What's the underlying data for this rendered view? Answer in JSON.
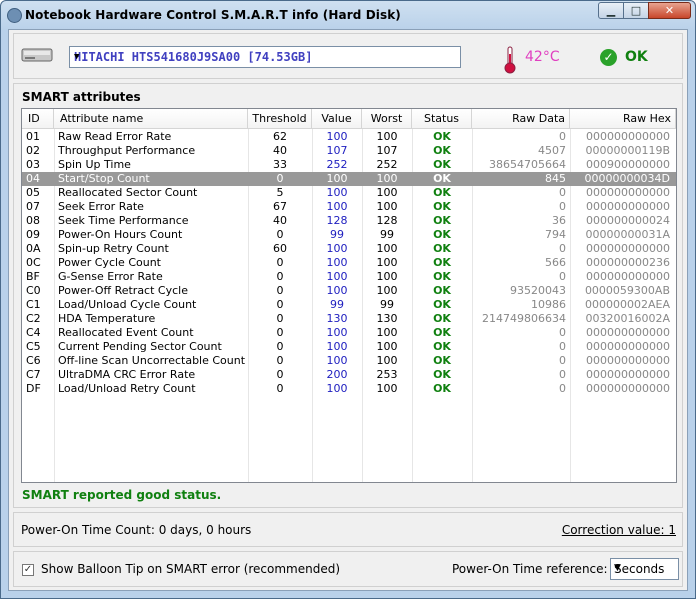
{
  "window": {
    "title": "Notebook Hardware Control  S.M.A.R.T  info (Hard Disk)",
    "minimize": "▁",
    "maximize": "□",
    "close": "✕"
  },
  "disk": {
    "selected": "HITACHI HTS541680J9SA00  [74.53GB]",
    "temperature": "42°C",
    "status": "OK",
    "accent_temp_color": "#e040c0",
    "ok_color": "#108010"
  },
  "smart": {
    "section_title": "SMART attributes",
    "columns": [
      "ID",
      "Attribute name",
      "Threshold",
      "Value",
      "Worst",
      "Status",
      "Raw Data",
      "Raw Hex"
    ],
    "rows": [
      {
        "id": "01",
        "name": "Raw Read Error Rate",
        "thr": "62",
        "val": "100",
        "worst": "100",
        "status": "OK",
        "raw": "0",
        "hex": "000000000000"
      },
      {
        "id": "02",
        "name": "Throughput Performance",
        "thr": "40",
        "val": "107",
        "worst": "107",
        "status": "OK",
        "raw": "4507",
        "hex": "00000000119B"
      },
      {
        "id": "03",
        "name": "Spin Up Time",
        "thr": "33",
        "val": "252",
        "worst": "252",
        "status": "OK",
        "raw": "38654705664",
        "hex": "000900000000"
      },
      {
        "id": "04",
        "name": "Start/Stop Count",
        "thr": "0",
        "val": "100",
        "worst": "100",
        "status": "OK",
        "raw": "845",
        "hex": "00000000034D"
      },
      {
        "id": "05",
        "name": "Reallocated Sector Count",
        "thr": "5",
        "val": "100",
        "worst": "100",
        "status": "OK",
        "raw": "0",
        "hex": "000000000000"
      },
      {
        "id": "07",
        "name": "Seek Error Rate",
        "thr": "67",
        "val": "100",
        "worst": "100",
        "status": "OK",
        "raw": "0",
        "hex": "000000000000"
      },
      {
        "id": "08",
        "name": "Seek Time Performance",
        "thr": "40",
        "val": "128",
        "worst": "128",
        "status": "OK",
        "raw": "36",
        "hex": "000000000024"
      },
      {
        "id": "09",
        "name": "Power-On Hours Count",
        "thr": "0",
        "val": "99",
        "worst": "99",
        "status": "OK",
        "raw": "794",
        "hex": "00000000031A"
      },
      {
        "id": "0A",
        "name": "Spin-up Retry Count",
        "thr": "60",
        "val": "100",
        "worst": "100",
        "status": "OK",
        "raw": "0",
        "hex": "000000000000"
      },
      {
        "id": "0C",
        "name": "Power Cycle Count",
        "thr": "0",
        "val": "100",
        "worst": "100",
        "status": "OK",
        "raw": "566",
        "hex": "000000000236"
      },
      {
        "id": "BF",
        "name": "G-Sense Error Rate",
        "thr": "0",
        "val": "100",
        "worst": "100",
        "status": "OK",
        "raw": "0",
        "hex": "000000000000"
      },
      {
        "id": "C0",
        "name": "Power-Off Retract Cycle",
        "thr": "0",
        "val": "100",
        "worst": "100",
        "status": "OK",
        "raw": "93520043",
        "hex": "0000059300AB"
      },
      {
        "id": "C1",
        "name": "Load/Unload Cycle Count",
        "thr": "0",
        "val": "99",
        "worst": "99",
        "status": "OK",
        "raw": "10986",
        "hex": "000000002AEA"
      },
      {
        "id": "C2",
        "name": "HDA Temperature",
        "thr": "0",
        "val": "130",
        "worst": "130",
        "status": "OK",
        "raw": "214749806634",
        "hex": "00320016002A"
      },
      {
        "id": "C4",
        "name": "Reallocated Event Count",
        "thr": "0",
        "val": "100",
        "worst": "100",
        "status": "OK",
        "raw": "0",
        "hex": "000000000000"
      },
      {
        "id": "C5",
        "name": "Current Pending Sector Count",
        "thr": "0",
        "val": "100",
        "worst": "100",
        "status": "OK",
        "raw": "0",
        "hex": "000000000000"
      },
      {
        "id": "C6",
        "name": "Off-line Scan Uncorrectable Count",
        "thr": "0",
        "val": "100",
        "worst": "100",
        "status": "OK",
        "raw": "0",
        "hex": "000000000000"
      },
      {
        "id": "C7",
        "name": "UltraDMA CRC Error Rate",
        "thr": "0",
        "val": "200",
        "worst": "253",
        "status": "OK",
        "raw": "0",
        "hex": "000000000000"
      },
      {
        "id": "DF",
        "name": "Load/Unload Retry Count",
        "thr": "0",
        "val": "100",
        "worst": "100",
        "status": "OK",
        "raw": "0",
        "hex": "000000000000"
      }
    ],
    "selected_row": 3,
    "status_message": "SMART reported good status."
  },
  "power": {
    "count_text": "Power-On Time Count:  0 days,  0 hours",
    "correction_text": "Correction value:  1"
  },
  "bottom": {
    "balloon_label": "Show Balloon Tip on SMART error (recommended)",
    "balloon_checked": "✓",
    "ref_label": "Power-On Time reference:",
    "ref_value": "Seconds"
  }
}
